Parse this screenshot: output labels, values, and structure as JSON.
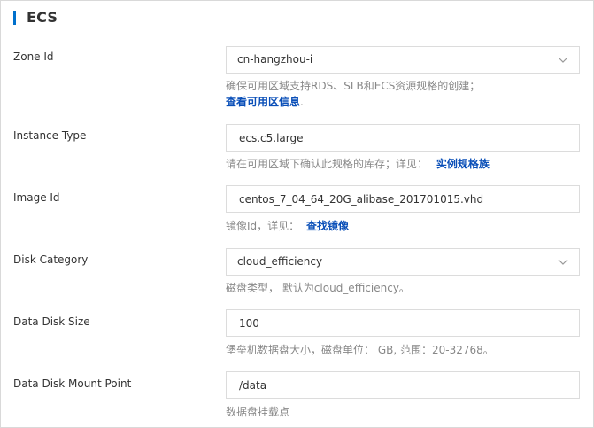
{
  "section": {
    "title": "ECS"
  },
  "fields": {
    "zone": {
      "label": "Zone Id",
      "value": "cn-hangzhou-i",
      "help": "确保可用区域支持RDS、SLB和ECS资源规格的创建；",
      "link": "查看可用区信息",
      "link_suffix": "."
    },
    "instance_type": {
      "label": "Instance Type",
      "value": "ecs.c5.large",
      "help": "请在可用区域下确认此规格的库存；详见：",
      "link": "实例规格族"
    },
    "image": {
      "label": "Image Id",
      "value": "centos_7_04_64_20G_alibase_201701015.vhd",
      "help": "镜像Id，详见：",
      "link": "查找镜像"
    },
    "disk_category": {
      "label": "Disk Category",
      "value": "cloud_efficiency",
      "help": "磁盘类型， 默认为cloud_efficiency。"
    },
    "data_disk_size": {
      "label": "Data Disk Size",
      "value": "100",
      "help": "堡垒机数据盘大小，磁盘单位： GB, 范围：20-32768。"
    },
    "mount_point": {
      "label": "Data Disk Mount Point",
      "value": "/data",
      "help": "数据盘挂载点"
    }
  },
  "icons": {
    "dropdown": "chevron-down-icon"
  },
  "colors": {
    "accent": "#0070cc",
    "link": "#0a4fb8",
    "help": "#888888",
    "border": "#dcdcdc"
  }
}
